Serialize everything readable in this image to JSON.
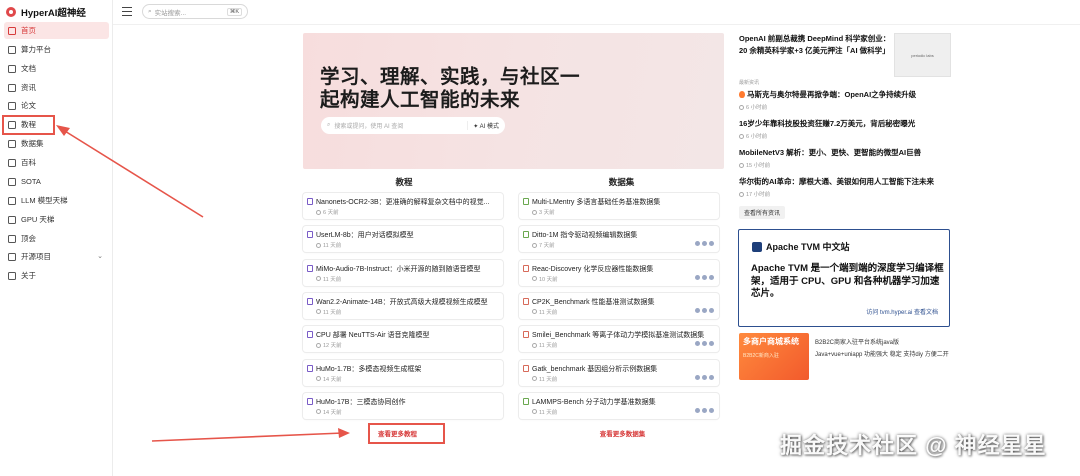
{
  "app": {
    "title": "HyperAI超神经"
  },
  "sidebar": {
    "items": [
      {
        "label": "首页",
        "active": true
      },
      {
        "label": "算力平台"
      },
      {
        "label": "文档"
      },
      {
        "label": "资讯"
      },
      {
        "label": "论文"
      },
      {
        "label": "教程"
      },
      {
        "label": "数据集"
      },
      {
        "label": "百科"
      },
      {
        "label": "SOTA"
      },
      {
        "label": "LLM 模型天梯"
      },
      {
        "label": "GPU 天梯"
      },
      {
        "label": "顶会"
      },
      {
        "label": "开源项目",
        "expandable": true
      },
      {
        "label": "关于"
      }
    ]
  },
  "topbar": {
    "search_placeholder": "实站搜索...",
    "search_shortcut": "⌘K"
  },
  "hero": {
    "title": "学习、理解、实践，与社区一起构建人工智能的未来",
    "search_placeholder": "搜索或提问，使用 AI 查阅",
    "ai_mode_label": "AI 模式"
  },
  "tutorials": {
    "heading": "教程",
    "more_label": "查看更多教程",
    "items": [
      {
        "title": "Nanonets-OCR2-3B：更准确的解释复杂文档中的视觉...",
        "time": "6 天前"
      },
      {
        "title": "UserLM-8b：用户对话模拟模型",
        "time": "11 天前"
      },
      {
        "title": "MiMo-Audio-7B-Instruct：小米开源的随到随语音模型",
        "time": "11 天前"
      },
      {
        "title": "Wan2.2-Animate-14B：开放式高级大规模视频生成模型",
        "time": "11 天前"
      },
      {
        "title": "CPU 部署 NeuTTS-Air 语音克隆模型",
        "time": "12 天前"
      },
      {
        "title": "HuMo-1.7B：多模态视频生成框架",
        "time": "14 天前"
      },
      {
        "title": "HuMo-17B：三模态协同创作",
        "time": "14 天前"
      }
    ]
  },
  "datasets": {
    "heading": "数据集",
    "more_label": "查看更多数据集",
    "items": [
      {
        "title": "Multi-LMentry 多语言基础任务基准数据集",
        "time": "3 天前"
      },
      {
        "title": "Ditto-1M 指令驱动视频编辑数据集",
        "time": "7 天前"
      },
      {
        "title": "Reac-Discovery 化学反应器性能数据集",
        "time": "10 天前"
      },
      {
        "title": "CP2K_Benchmark 性能基准测试数据集",
        "time": "11 天前"
      },
      {
        "title": "Smilei_Benchmark 等离子体动力学模拟基准测试数据集",
        "time": "11 天前"
      },
      {
        "title": "Gatk_benchmark 基因组分析示例数据集",
        "time": "11 天前"
      },
      {
        "title": "LAMMPS-Bench 分子动力学基准数据集",
        "time": "11 天前"
      }
    ]
  },
  "news": {
    "lead": "OpenAI 前副总裁携 DeepMind 科学家创业：20 余精英科学家+3 亿美元押注「AI 做科学」",
    "thumb_label": "periodic labs",
    "section_label": "最新资讯",
    "items": [
      {
        "title": "马斯克与奥尔特曼再掀争端：OpenAI之争持续升级",
        "time": "6 小时前",
        "hot": true
      },
      {
        "title": "16岁少年靠科技股投资狂赚7.2万美元，背后秘密曝光",
        "time": "6 小时前"
      },
      {
        "title": "MobileNetV3 解析：更小、更快、更智能的微型AI巨兽",
        "time": "15 小时前"
      },
      {
        "title": "华尔街的AI革命：摩根大通、美银如何用人工智能下注未来",
        "time": "17 小时前"
      }
    ],
    "all_label": "查看所有资讯"
  },
  "tvm": {
    "title": "Apache TVM 中文站",
    "body": "Apache TVM 是一个端到端的深度学习编译框架，适用于 CPU、GPU 和各种机器学习加速芯片。",
    "link": "访问 tvm.hyper.ai 查看文档"
  },
  "ad": {
    "image_text": "多商户商城系统",
    "image_sub": "B2B2C新商入驻",
    "title": "B2B2C商家入驻平台系统java版",
    "desc": "Java+vue+uniapp 功能强大 稳定 支持diy 方便二开"
  },
  "watermark": "掘金技术社区 @ 神经星星",
  "colors": {
    "accent": "#d73a3a",
    "annotation": "#e6554a",
    "tvm": "#2d4f8f"
  }
}
